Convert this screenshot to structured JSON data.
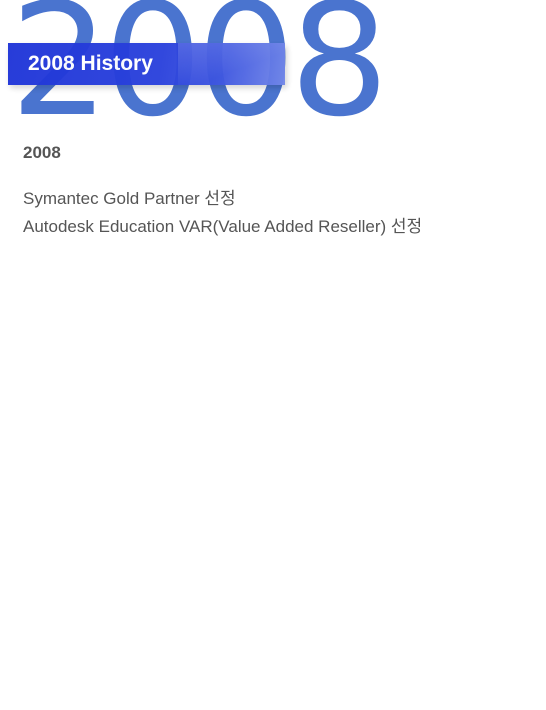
{
  "hero": {
    "background_year": "2008",
    "title": "2008 History",
    "accent_color": "#2a41dc",
    "year_color": "#4a74cf"
  },
  "section": {
    "year": "2008",
    "events": [
      "Symantec Gold Partner 선정",
      "Autodesk Education VAR(Value Added Reseller) 선정"
    ]
  }
}
